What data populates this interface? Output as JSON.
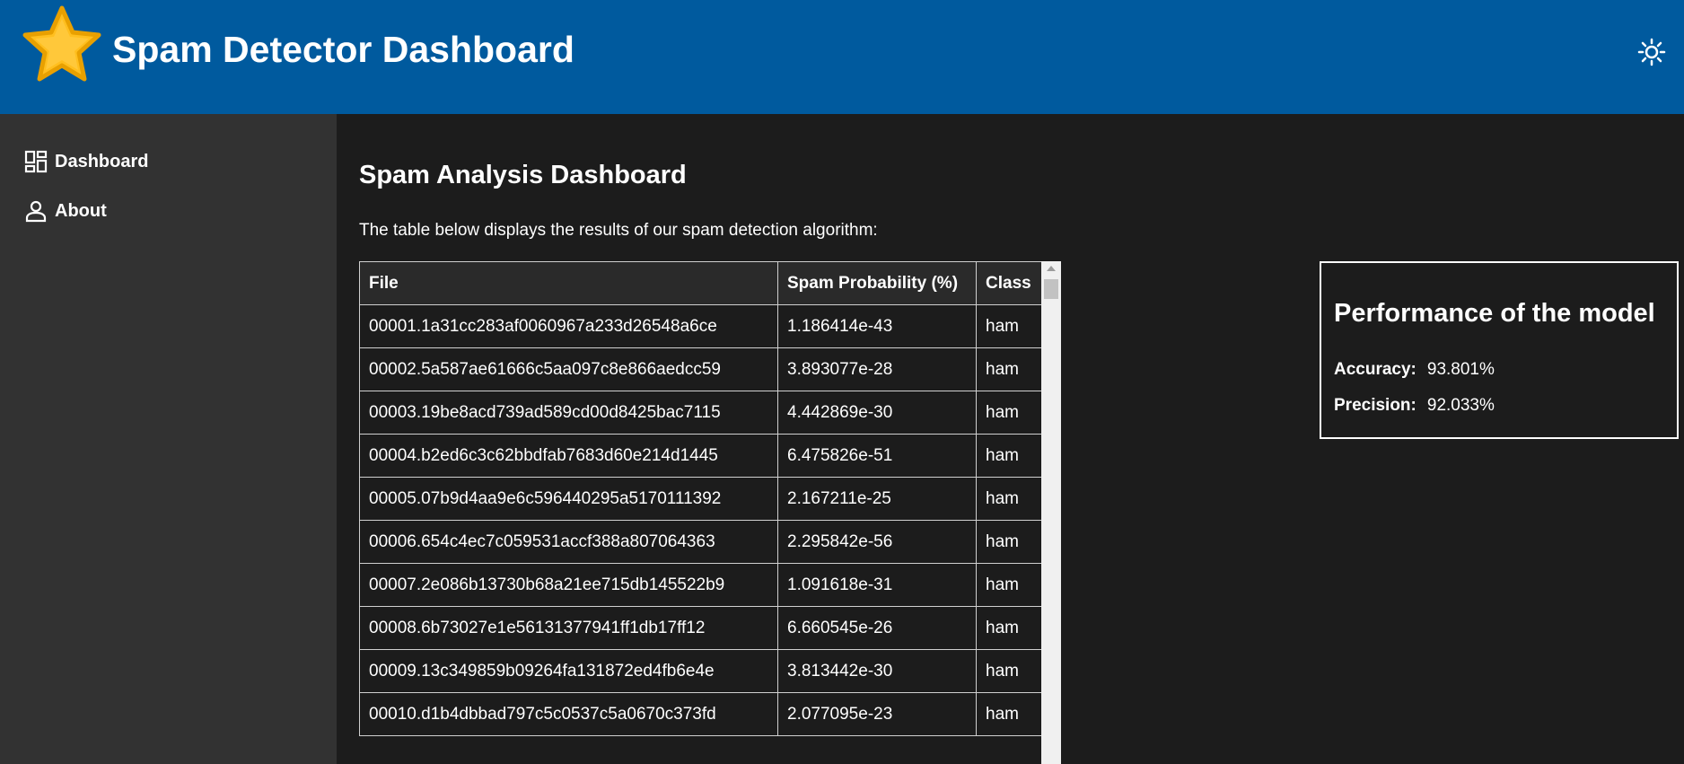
{
  "header": {
    "title": "Spam Detector Dashboard",
    "logo_icon": "star-icon",
    "theme_icon": "sun-icon",
    "brand_color": "#005a9e"
  },
  "sidebar": {
    "items": [
      {
        "label": "Dashboard",
        "icon": "dashboard-icon"
      },
      {
        "label": "About",
        "icon": "person-icon"
      }
    ]
  },
  "main": {
    "title": "Spam Analysis Dashboard",
    "description": "The table below displays the results of our spam detection algorithm:",
    "table": {
      "headers": [
        "File",
        "Spam Probability (%)",
        "Class"
      ],
      "rows": [
        [
          "00001.1a31cc283af0060967a233d26548a6ce",
          "1.186414e-43",
          "ham"
        ],
        [
          "00002.5a587ae61666c5aa097c8e866aedcc59",
          "3.893077e-28",
          "ham"
        ],
        [
          "00003.19be8acd739ad589cd00d8425bac7115",
          "4.442869e-30",
          "ham"
        ],
        [
          "00004.b2ed6c3c62bbdfab7683d60e214d1445",
          "6.475826e-51",
          "ham"
        ],
        [
          "00005.07b9d4aa9e6c596440295a5170111392",
          "2.167211e-25",
          "ham"
        ],
        [
          "00006.654c4ec7c059531accf388a807064363",
          "2.295842e-56",
          "ham"
        ],
        [
          "00007.2e086b13730b68a21ee715db145522b9",
          "1.091618e-31",
          "ham"
        ],
        [
          "00008.6b73027e1e56131377941ff1db17ff12",
          "6.660545e-26",
          "ham"
        ],
        [
          "00009.13c349859b09264fa131872ed4fb6e4e",
          "3.813442e-30",
          "ham"
        ],
        [
          "00010.d1b4dbbad797c5c0537c5a0670c373fd",
          "2.077095e-23",
          "ham"
        ]
      ]
    }
  },
  "performance": {
    "title": "Performance of the model",
    "accuracy_label": "Accuracy:",
    "accuracy_value": "93.801%",
    "precision_label": "Precision:",
    "precision_value": "92.033%"
  }
}
